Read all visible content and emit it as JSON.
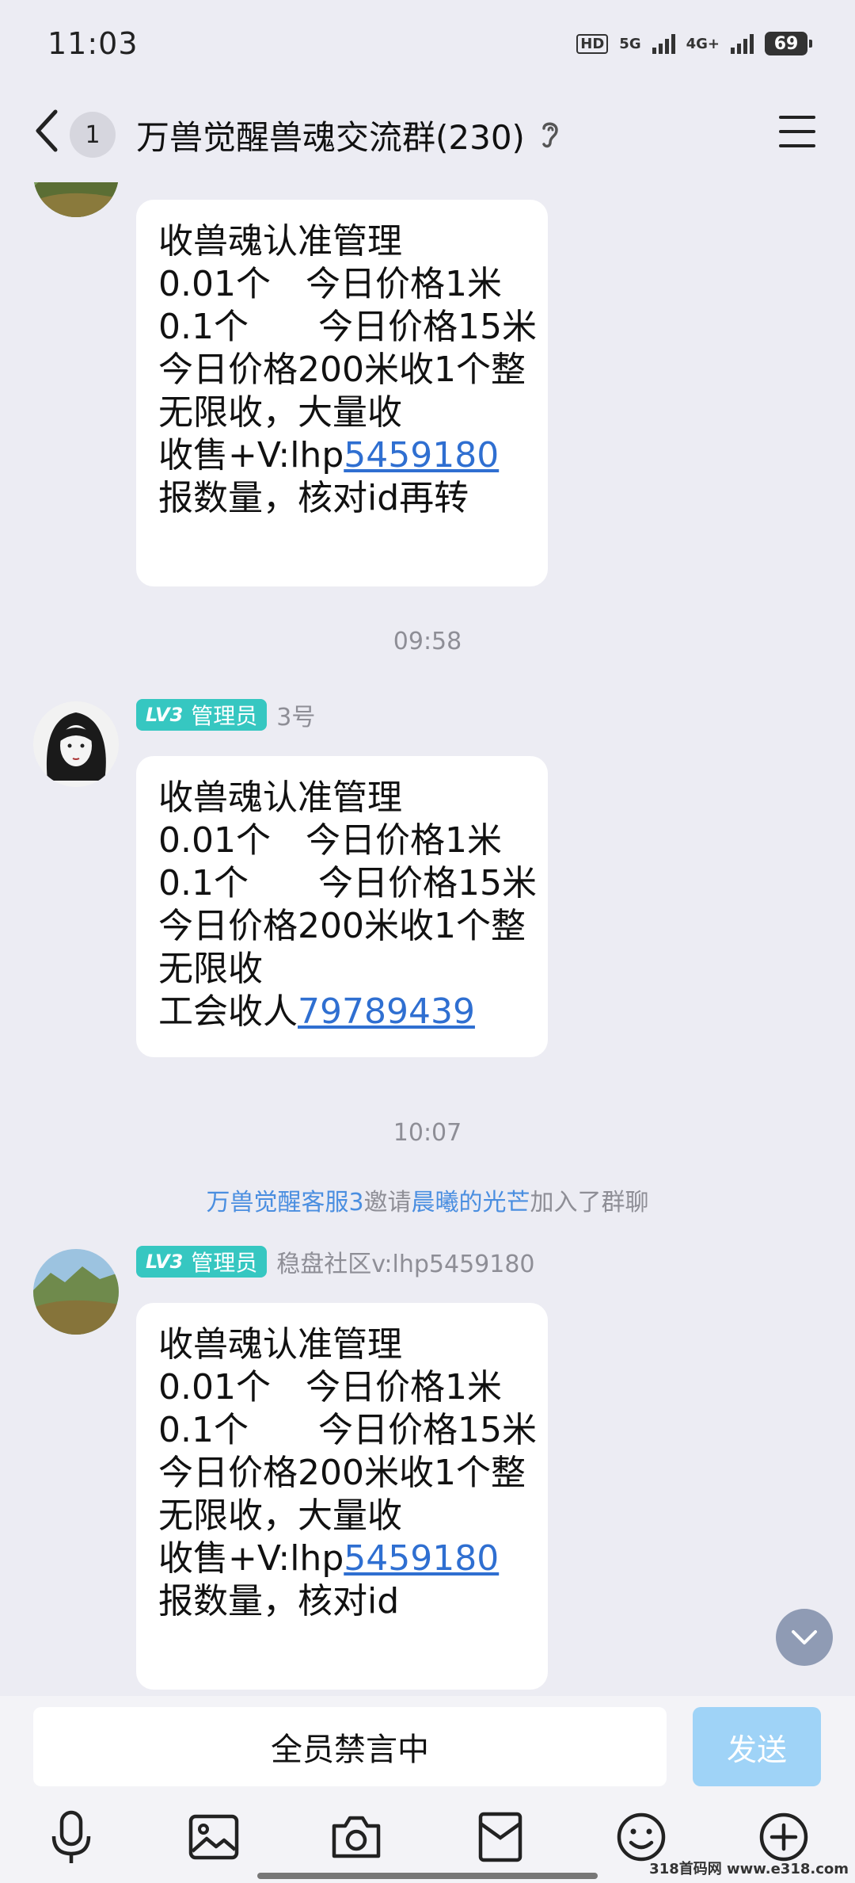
{
  "status_bar": {
    "time": "11:03",
    "hd_label": "HD",
    "net1": "5G",
    "net2": "4G+",
    "battery": "69"
  },
  "nav": {
    "unread_count": "1",
    "title": "万兽觉醒兽魂交流群(230)"
  },
  "messages": [
    {
      "lines": [
        "收兽魂认准管理",
        "0.01个　今日价格1米",
        "0.1个　　今日价格15米",
        "今日价格200米收1个整",
        "无限收，大量收"
      ],
      "link_prefix": "收售+V:lhp",
      "link_text": "5459180",
      "last_line": "报数量，核对id再转"
    },
    {
      "time": "09:58",
      "role_level": "LV3",
      "role_label": "管理员",
      "sender": "3号",
      "lines": [
        "收兽魂认准管理",
        "0.01个　今日价格1米",
        "0.1个　　今日价格15米",
        "今日价格200米收1个整",
        "无限收"
      ],
      "link_prefix": "工会收人",
      "link_text": "79789439"
    },
    {
      "time": "10:07",
      "system_note": {
        "inviter": "万兽觉醒客服3",
        "verb": "邀请",
        "invitee": "晨曦的光芒",
        "suffix": "加入了群聊"
      },
      "role_level": "LV3",
      "role_label": "管理员",
      "sender": "稳盘社区v:lhp5459180",
      "lines": [
        "收兽魂认准管理",
        "0.01个　今日价格1米",
        "0.1个　　今日价格15米",
        "今日价格200米收1个整",
        "无限收，大量收"
      ],
      "link_prefix": "收售+V:lhp",
      "link_text": "5459180",
      "last_line": "报数量，核对id"
    }
  ],
  "input": {
    "muted_text": "全员禁言中",
    "send_label": "发送"
  },
  "toolbar_icons": [
    "mic-icon",
    "image-icon",
    "camera-icon",
    "red-packet-icon",
    "emoji-icon",
    "plus-icon"
  ],
  "watermark": "318首码网 www.e318.com",
  "colors": {
    "link": "#2f6fd1",
    "badge": "#36c7c1",
    "send_disabled": "#9fd3f7"
  }
}
